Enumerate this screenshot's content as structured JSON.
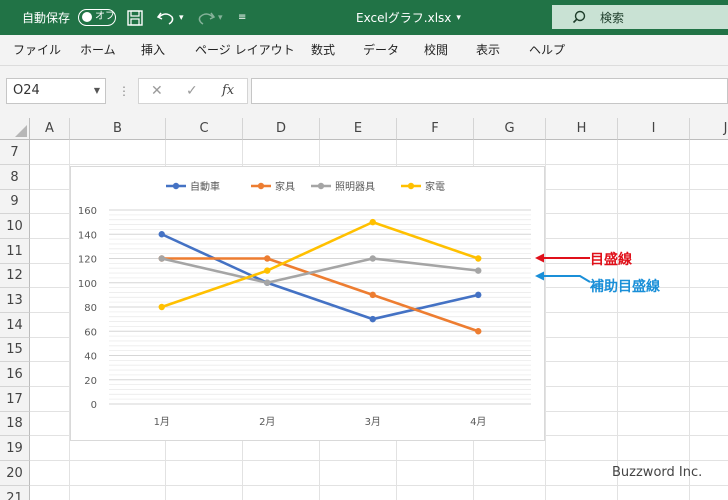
{
  "titlebar": {
    "autosave_label": "自動保存",
    "autosave_state": "オフ",
    "filename": "Excelグラフ.xlsx",
    "search_label": "検索",
    "bg_color": "#217346"
  },
  "ribbon": {
    "tabs": [
      "ファイル",
      "ホーム",
      "挿入",
      "ページ レイアウト",
      "数式",
      "データ",
      "校閲",
      "表示",
      "ヘルプ"
    ]
  },
  "formula_bar": {
    "name_box": "O24",
    "fx_label": "fx",
    "value": ""
  },
  "sheet": {
    "columns": [
      "A",
      "B",
      "C",
      "D",
      "E",
      "F",
      "G",
      "H",
      "I",
      "J"
    ],
    "rows": [
      "7",
      "8",
      "9",
      "10",
      "11",
      "12",
      "13",
      "14",
      "15",
      "16",
      "17",
      "18",
      "19",
      "20",
      "21"
    ]
  },
  "chart_data": {
    "type": "line",
    "categories": [
      "1月",
      "2月",
      "3月",
      "4月"
    ],
    "series": [
      {
        "name": "自動車",
        "values": [
          140,
          100,
          70,
          90
        ],
        "color": "#4472c4"
      },
      {
        "name": "家具",
        "values": [
          120,
          120,
          90,
          60
        ],
        "color": "#ed7d31"
      },
      {
        "name": "照明器具",
        "values": [
          120,
          100,
          120,
          110
        ],
        "color": "#a5a5a5"
      },
      {
        "name": "家電",
        "values": [
          80,
          110,
          150,
          120
        ],
        "color": "#ffc000"
      }
    ],
    "ylim": [
      0,
      160
    ],
    "major_unit": 20,
    "minor_unit": 4,
    "y_ticks": [
      "0",
      "20",
      "40",
      "60",
      "80",
      "100",
      "120",
      "140",
      "160"
    ],
    "legend_position": "top",
    "gridlines": "major and minor"
  },
  "annotations": {
    "major_label": "目盛線",
    "major_color": "#e0101a",
    "minor_label": "補助目盛線",
    "minor_color": "#1a8fd8"
  },
  "credit": "Buzzword Inc."
}
